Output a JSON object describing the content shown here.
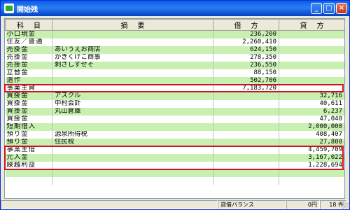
{
  "window": {
    "title": "開始残"
  },
  "titlebar_buttons": {
    "minimize": "_",
    "maximize": "□",
    "close": "×"
  },
  "table": {
    "headers": [
      "科目",
      "摘要",
      "借方",
      "貸方"
    ],
    "rows": [
      {
        "kamoku": "小口現金",
        "tekiyo": "",
        "kari": "236,200",
        "kashi": ""
      },
      {
        "kamoku": "住友／普通",
        "tekiyo": "",
        "kari": "2,260,410",
        "kashi": ""
      },
      {
        "kamoku": "売掛金",
        "tekiyo": "あいうえお商店",
        "kari": "624,150",
        "kashi": ""
      },
      {
        "kamoku": "売掛金",
        "tekiyo": "かきくけこ商事",
        "kari": "278,350",
        "kashi": ""
      },
      {
        "kamoku": "売掛金",
        "tekiyo": "刺さしすせそ",
        "kari": "236,550",
        "kashi": ""
      },
      {
        "kamoku": "立替金",
        "tekiyo": "",
        "kari": "88,150",
        "kashi": ""
      },
      {
        "kamoku": "造作",
        "tekiyo": "",
        "kari": "502,706",
        "kashi": ""
      },
      {
        "kamoku": "事業主貸",
        "tekiyo": "",
        "kari": "7,183,720",
        "kashi": ""
      },
      {
        "kamoku": "買掛金",
        "tekiyo": "アスクル",
        "kari": "",
        "kashi": "32,716"
      },
      {
        "kamoku": "買掛金",
        "tekiyo": "中村会計",
        "kari": "",
        "kashi": "40,611"
      },
      {
        "kamoku": "買掛金",
        "tekiyo": "丸山倉庫",
        "kari": "",
        "kashi": "6,237"
      },
      {
        "kamoku": "買掛金",
        "tekiyo": "",
        "kari": "",
        "kashi": "47,040"
      },
      {
        "kamoku": "短期借入",
        "tekiyo": "",
        "kari": "",
        "kashi": "2,000,000"
      },
      {
        "kamoku": "預り金",
        "tekiyo": "源泉所得税",
        "kari": "",
        "kashi": "408,407"
      },
      {
        "kamoku": "預り金",
        "tekiyo": "住民税",
        "kari": "",
        "kashi": "27,800"
      },
      {
        "kamoku": "事業主借",
        "tekiyo": "",
        "kari": "",
        "kashi": "4,459,709"
      },
      {
        "kamoku": "元入金",
        "tekiyo": "",
        "kari": "",
        "kashi": "3,167,022"
      },
      {
        "kamoku": "繰越利益",
        "tekiyo": "",
        "kari": "",
        "kashi": "1,228,694"
      }
    ]
  },
  "status": {
    "balance_label": "貸借バランス",
    "balance_value": "0円",
    "count": "18 件"
  },
  "colors": {
    "row_green": "#c8f0b0",
    "highlight": "#d01020",
    "titlebar": "#0a5fe8"
  }
}
